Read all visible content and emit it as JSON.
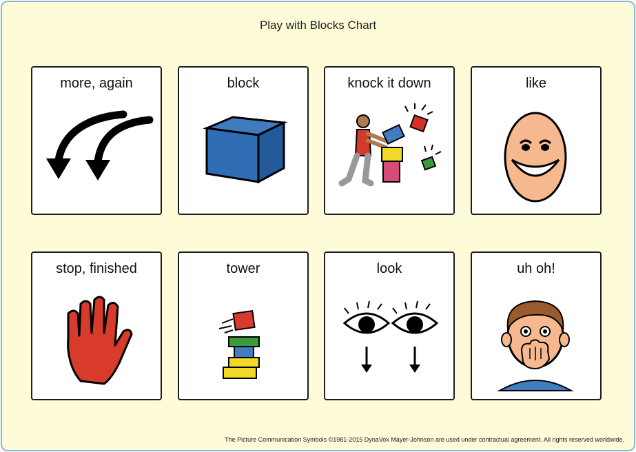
{
  "chart": {
    "title": "Play with Blocks Chart",
    "footer": "The Picture Communication Symbols ©1981-2015 DynaVox Mayer-Johnson are used under contractual agreement.  All rights reserved worldwide."
  },
  "cards": [
    {
      "label": "more, again",
      "icon": "curved-arrows-icon"
    },
    {
      "label": "block",
      "icon": "blue-cube-icon"
    },
    {
      "label": "knock it down",
      "icon": "person-knocking-blocks-icon"
    },
    {
      "label": "like",
      "icon": "smiling-face-icon"
    },
    {
      "label": "stop, finished",
      "icon": "red-hand-icon"
    },
    {
      "label": "tower",
      "icon": "block-tower-icon"
    },
    {
      "label": "look",
      "icon": "eyes-looking-down-icon"
    },
    {
      "label": "uh oh!",
      "icon": "surprised-boy-icon"
    }
  ],
  "colors": {
    "background": "#fefbd9",
    "border": "#8eb4d6",
    "card_border": "#1c1c1c"
  }
}
